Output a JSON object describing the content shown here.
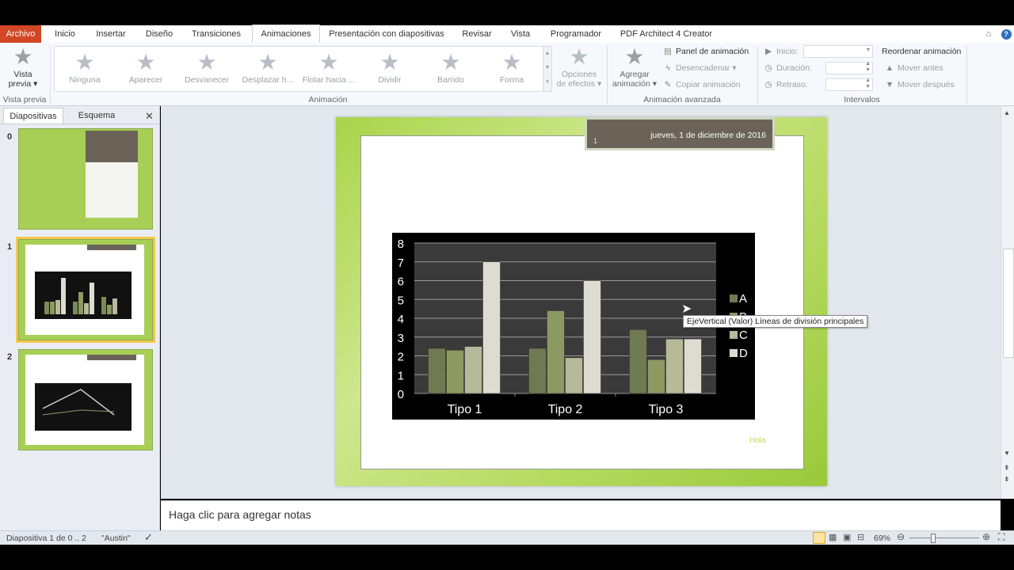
{
  "tabs": [
    "Archivo",
    "Inicio",
    "Insertar",
    "Diseño",
    "Transiciones",
    "Animaciones",
    "Presentación con diapositivas",
    "Revisar",
    "Vista",
    "Programador",
    "PDF Architect 4 Creator"
  ],
  "ribbon": {
    "preview": {
      "label1": "Vista",
      "label2": "previa",
      "group": "Vista previa"
    },
    "gallery_items": [
      "Ninguna",
      "Aparecer",
      "Desvanecer",
      "Desplazar h...",
      "Flotar hacia ...",
      "Dividir",
      "Barrido",
      "Forma"
    ],
    "animation_group": "Animación",
    "effect_options": {
      "label1": "Opciones",
      "label2": "de efectos"
    },
    "add_animation": {
      "label1": "Agregar",
      "label2": "animación"
    },
    "advanced": {
      "panel": "Panel de animación",
      "trigger": "Desencadenar",
      "copy": "Copiar animación",
      "group": "Animación avanzada"
    },
    "timing": {
      "start": "Inicio:",
      "duration": "Duración:",
      "delay": "Retraso:",
      "group": "Intervalos"
    },
    "reorder": {
      "title": "Reordenar animación",
      "earlier": "Mover antes",
      "later": "Mover después"
    }
  },
  "panel": {
    "tab_slides": "Diapositivas",
    "tab_outline": "Esquema",
    "slides": [
      "0",
      "1",
      "2"
    ]
  },
  "slide": {
    "number": "1",
    "date": "jueves, 1 de diciembre de 2016",
    "footer": "Hola"
  },
  "chart_data": {
    "type": "bar",
    "categories": [
      "Tipo 1",
      "Tipo 2",
      "Tipo 3"
    ],
    "series": [
      {
        "name": "A",
        "values": [
          2.4,
          2.4,
          3.4
        ]
      },
      {
        "name": "B",
        "values": [
          2.3,
          4.4,
          1.8
        ]
      },
      {
        "name": "C",
        "values": [
          2.5,
          1.9,
          2.9
        ]
      },
      {
        "name": "D",
        "values": [
          7.0,
          6.0,
          2.9
        ]
      }
    ],
    "yticks": [
      "0",
      "1",
      "2",
      "3",
      "4",
      "5",
      "6",
      "7",
      "8"
    ],
    "ylim": [
      0,
      8
    ],
    "grid": true,
    "legend": "right",
    "colors": [
      "#6f7a52",
      "#8c9a62",
      "#b6b99a",
      "#dcdcd0"
    ]
  },
  "tooltip": "EjeVertical (Valor) Líneas de división principales",
  "notes_placeholder": "Haga clic para agregar notas",
  "status": {
    "slide": "Diapositiva 1 de 0 .. 2",
    "theme": "\"Austin\"",
    "zoom": "69%"
  },
  "colors": {
    "file_tab": "#d24726",
    "slide_green": "#a9d44a",
    "date_box": "#6b6358"
  }
}
